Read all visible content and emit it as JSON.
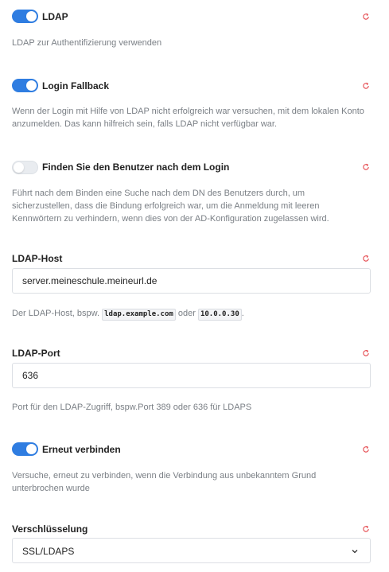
{
  "accent_color": "#2f7de1",
  "reset_icon_color": "#e5484d",
  "settings": {
    "ldap": {
      "label": "LDAP",
      "enabled": true,
      "description": "LDAP zur Authentifizierung verwenden"
    },
    "login_fallback": {
      "label": "Login Fallback",
      "enabled": true,
      "description": "Wenn der Login mit Hilfe von LDAP nicht erfolgreich war versuchen, mit dem lokalen Konto anzumelden. Das kann hilfreich sein, falls LDAP nicht verfügbar war."
    },
    "search_after_login": {
      "label": "Finden Sie den Benutzer nach dem Login",
      "enabled": false,
      "description": "Führt nach dem Binden eine Suche nach dem DN des Benutzers durch, um sicherzustellen, dass die Bindung erfolgreich war, um die Anmeldung mit leeren Kennwörtern zu verhindern, wenn dies von der AD-Konfiguration zugelassen wird."
    },
    "ldap_host": {
      "label": "LDAP-Host",
      "value": "server.meineschule.meineurl.de",
      "description_prefix": "Der LDAP-Host, bspw.",
      "example_1": "ldap.example.com",
      "description_middle": "oder",
      "example_2": "10.0.0.30",
      "description_suffix": "."
    },
    "ldap_port": {
      "label": "LDAP-Port",
      "value": "636",
      "description": "Port für den LDAP-Zugriff, bspw.Port 389 oder 636 für LDAPS"
    },
    "reconnect": {
      "label": "Erneut verbinden",
      "enabled": true,
      "description": "Versuche, erneut zu verbinden, wenn die Verbindung aus unbekanntem Grund unterbrochen wurde"
    },
    "encryption": {
      "label": "Verschlüsselung",
      "selected": "SSL/LDAPS"
    }
  }
}
